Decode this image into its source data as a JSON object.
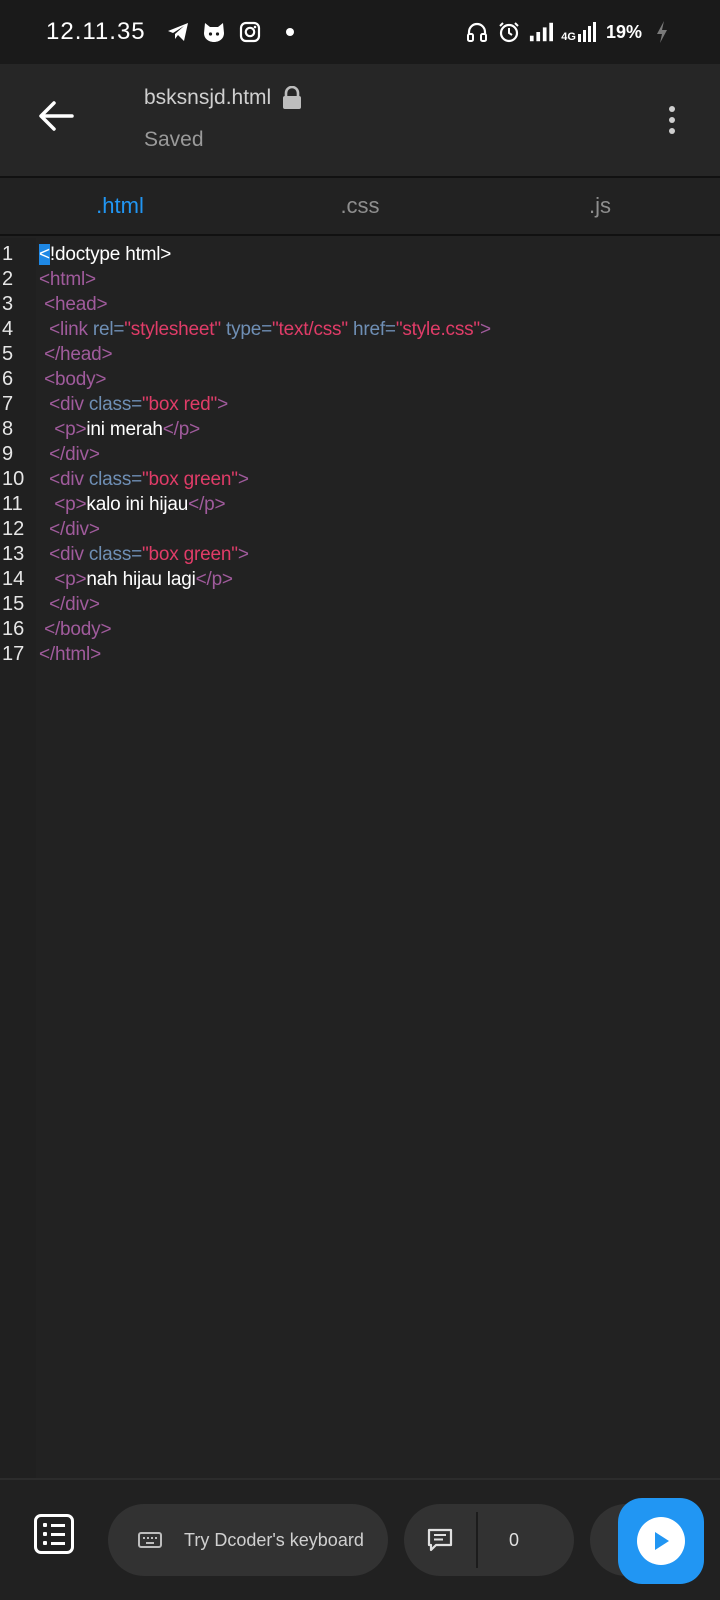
{
  "status_bar": {
    "time": "12.11.35",
    "battery_percent": "19%",
    "network": "4G",
    "icons": [
      "telegram-icon",
      "cat-app-icon",
      "instagram-icon",
      "notification-dot",
      "headset-icon",
      "alarm-icon",
      "signal-icon",
      "signal-4g-icon",
      "charging-icon"
    ]
  },
  "app_bar": {
    "file_name": "bsksnsjd.html",
    "save_status": "Saved"
  },
  "tabs": [
    {
      "label": ".html",
      "active": true
    },
    {
      "label": ".css",
      "active": false
    },
    {
      "label": ".js",
      "active": false
    }
  ],
  "editor": {
    "line_numbers": [
      "1",
      "2",
      "3",
      "4",
      "5",
      "6",
      "7",
      "8",
      "9",
      "10",
      "11",
      "12",
      "13",
      "14",
      "15",
      "16",
      "17"
    ],
    "lines": [
      [
        {
          "c": "cursor",
          "t": "<"
        },
        {
          "c": "t-txt",
          "t": "!doctype html>"
        }
      ],
      [
        {
          "c": "t-tag",
          "t": "<html>"
        }
      ],
      [
        {
          "c": "t-tag",
          "t": " <head>"
        }
      ],
      [
        {
          "c": "t-tag",
          "t": "  <link "
        },
        {
          "c": "t-attr",
          "t": "rel="
        },
        {
          "c": "t-str",
          "t": "\"stylesheet\""
        },
        {
          "c": "t-attr",
          "t": " type="
        },
        {
          "c": "t-str",
          "t": "\"text/css\""
        },
        {
          "c": "t-attr",
          "t": " href="
        },
        {
          "c": "t-str",
          "t": "\"style.css\""
        },
        {
          "c": "t-tag",
          "t": ">"
        }
      ],
      [
        {
          "c": "t-tag",
          "t": " </head>"
        }
      ],
      [
        {
          "c": "t-tag",
          "t": " <body>"
        }
      ],
      [
        {
          "c": "t-tag",
          "t": "  <div "
        },
        {
          "c": "t-attr",
          "t": "class="
        },
        {
          "c": "t-str",
          "t": "\"box red\""
        },
        {
          "c": "t-tag",
          "t": ">"
        }
      ],
      [
        {
          "c": "t-tag",
          "t": "   <p>"
        },
        {
          "c": "t-txt",
          "t": "ini merah"
        },
        {
          "c": "t-tag",
          "t": "</p>"
        }
      ],
      [
        {
          "c": "t-tag",
          "t": "  </div>"
        }
      ],
      [
        {
          "c": "t-tag",
          "t": "  <div "
        },
        {
          "c": "t-attr",
          "t": "class="
        },
        {
          "c": "t-str",
          "t": "\"box green\""
        },
        {
          "c": "t-tag",
          "t": ">"
        }
      ],
      [
        {
          "c": "t-tag",
          "t": "   <p>"
        },
        {
          "c": "t-txt",
          "t": "kalo ini hijau"
        },
        {
          "c": "t-tag",
          "t": "</p>"
        }
      ],
      [
        {
          "c": "t-tag",
          "t": "  </div>"
        }
      ],
      [
        {
          "c": "t-tag",
          "t": "  <div "
        },
        {
          "c": "t-attr",
          "t": "class="
        },
        {
          "c": "t-str",
          "t": "\"box green\""
        },
        {
          "c": "t-tag",
          "t": ">"
        }
      ],
      [
        {
          "c": "t-tag",
          "t": "   <p>"
        },
        {
          "c": "t-txt",
          "t": "nah hijau lagi"
        },
        {
          "c": "t-tag",
          "t": "</p>"
        }
      ],
      [
        {
          "c": "t-tag",
          "t": "  </div>"
        }
      ],
      [
        {
          "c": "t-tag",
          "t": " </body>"
        }
      ],
      [
        {
          "c": "t-tag",
          "t": "</html>"
        }
      ]
    ]
  },
  "bottom_bar": {
    "keyboard_prompt": "Try Dcoder's keyboard",
    "comment_count": "0"
  },
  "colors": {
    "accent": "#2196f3",
    "tag": "#a05b9c",
    "attribute": "#6f8fb5",
    "string": "#e03c68",
    "background": "#222222"
  }
}
